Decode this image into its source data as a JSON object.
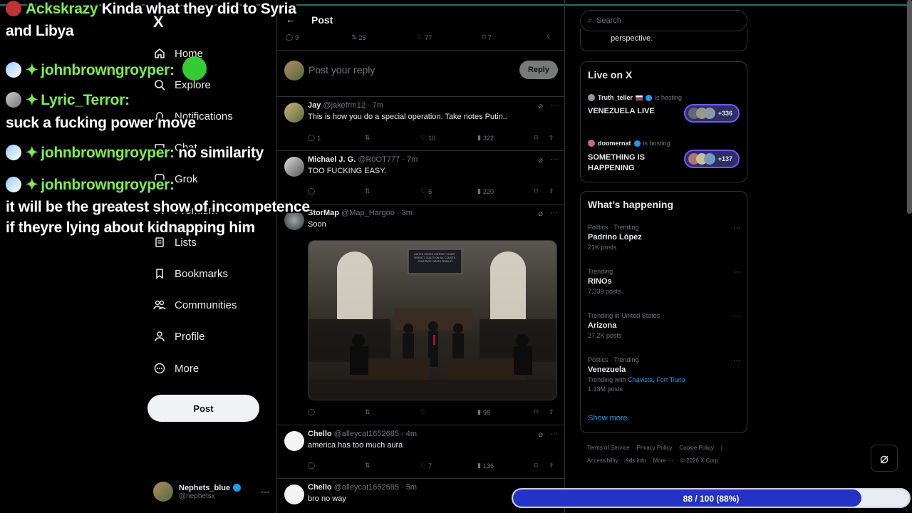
{
  "header": {
    "title": "Post",
    "back_icon": "arrow-left-icon"
  },
  "top_actions": {
    "replies": "9",
    "reposts": "25",
    "likes": "77",
    "bookmarks": "7"
  },
  "reply_box": {
    "placeholder": "Post your reply",
    "button": "Reply"
  },
  "nav": {
    "logo": "X",
    "items": [
      {
        "label": "Home",
        "icon": "home-icon"
      },
      {
        "label": "Explore",
        "icon": "search-icon"
      },
      {
        "label": "Notifications",
        "icon": "bell-icon"
      },
      {
        "label": "Chat",
        "icon": "mail-icon"
      },
      {
        "label": "Grok",
        "icon": "grok-icon"
      },
      {
        "label": "Premium",
        "icon": "x-icon"
      },
      {
        "label": "Lists",
        "icon": "list-icon"
      },
      {
        "label": "Bookmarks",
        "icon": "bookmark-icon"
      },
      {
        "label": "Communities",
        "icon": "people-icon"
      },
      {
        "label": "Profile",
        "icon": "person-icon"
      },
      {
        "label": "More",
        "icon": "more-circle-icon"
      }
    ],
    "post_button": "Post",
    "account": {
      "name": "Nephets_blue",
      "handle": "@nephetsx"
    }
  },
  "tweets": [
    {
      "name": "Jay",
      "handle": "@jakefrm12",
      "time": "· 7m",
      "text": "This is how you do a special operation. Take notes Putin..",
      "replies": "1",
      "reposts": "",
      "likes": "10",
      "views": "322"
    },
    {
      "name": "Michael J. G.",
      "handle": "@R0OT777",
      "time": "· 7m",
      "text": "TOO FUCKING EASY.",
      "replies": "",
      "reposts": "",
      "likes": "6",
      "views": "220"
    },
    {
      "name": "StorMap",
      "handle": "@Map_Hargoo",
      "time": "· 3m",
      "text": "Soon",
      "replies": "",
      "reposts": "",
      "likes": "",
      "views": "98",
      "image_caption": "UNITED STATES DISTRICT COURT · VERDICT: GUILTY ON ALL COUNTS · SENTENCE: DEATH PENALTY"
    },
    {
      "name": "Chello",
      "handle": "@alleycat1652685",
      "time": "· 4m",
      "text": "america has too much aura",
      "replies": "",
      "reposts": "",
      "likes": "7",
      "views": "136"
    },
    {
      "name": "Chello",
      "handle": "@alleycat1652685",
      "time": "· 5m",
      "text": "bro no way"
    }
  ],
  "right": {
    "search_placeholder": "Search",
    "top_card_text": "perspective.",
    "live": {
      "title": "Live on X",
      "hosts": [
        {
          "host": "Truth_teller",
          "hosting": "is hosting",
          "title": "VENEZUELA LIVE",
          "count": "+336"
        },
        {
          "host": "doomernat",
          "hosting": "is hosting",
          "title": "SOMETHING IS HAPPENING",
          "count": "+137"
        }
      ]
    },
    "trends": {
      "title": "What’s happening",
      "items": [
        {
          "meta": "Politics · Trending",
          "name": "Padrino López",
          "count": "21K posts"
        },
        {
          "meta": "Trending",
          "name": "RINOs",
          "count": "7,339 posts"
        },
        {
          "meta": "Trending in United States",
          "name": "Arizona",
          "count": "27.2K posts"
        },
        {
          "meta": "Politics · Trending",
          "name": "Venezuela",
          "with_prefix": "Trending with",
          "with_links": "Chavista, Fort Tiuna",
          "count": "1.13M posts"
        }
      ],
      "show_more": "Show more"
    },
    "footer": {
      "line1": [
        "Terms of Service",
        "Privacy Policy",
        "Cookie Policy",
        "|"
      ],
      "line2": [
        "Accessibility",
        "Ads info",
        "More ···",
        "© 2026 X Corp."
      ]
    }
  },
  "chat_overlay": [
    {
      "user": "Ackskrazy",
      "message": "Kinda what they did to Syria"
    },
    {
      "user": "",
      "message": "and Libya"
    },
    {
      "user": "johnbrowngroyper:",
      "message": ""
    },
    {
      "user": "Lyric_Terror:",
      "message": ""
    },
    {
      "user": "",
      "message": "suck a fucking power move"
    },
    {
      "user": "johnbrowngroyper:",
      "message": "no similarity"
    },
    {
      "user": "johnbrowngroyper:",
      "message": ""
    },
    {
      "user": "",
      "message": "it will be the greatest show of incompetence"
    },
    {
      "user": "",
      "message": "if theyre lying about kidnapping him"
    }
  ],
  "progress": {
    "label": "88 / 100 (88%)",
    "value": 0.88
  },
  "colors": {
    "accent": "#1d9bf0",
    "progress": "#2432c8",
    "chat_name": "#7ded4f"
  }
}
